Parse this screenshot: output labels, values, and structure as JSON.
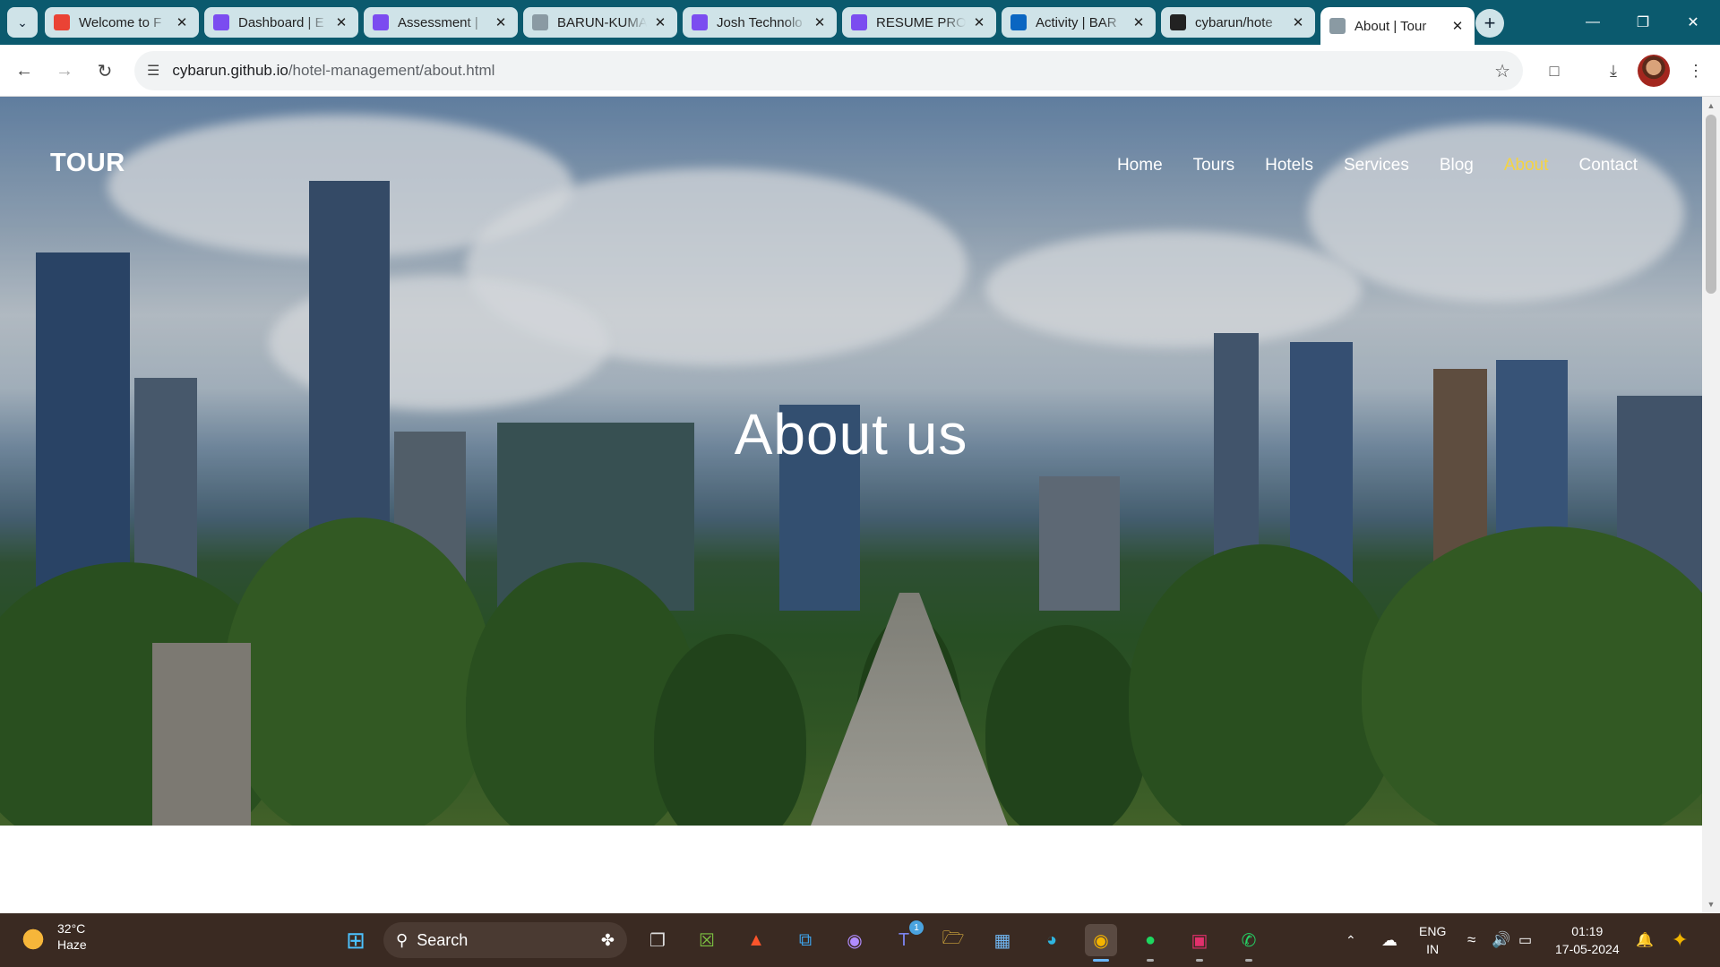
{
  "browser": {
    "tabs": [
      {
        "label": "Welcome to F",
        "favicon": "gmail-icon",
        "color": "#ea4335"
      },
      {
        "label": "Dashboard | E",
        "favicon": "unstop-icon",
        "color": "#7b4cf0"
      },
      {
        "label": "Assessment |",
        "favicon": "unstop-icon",
        "color": "#7b4cf0"
      },
      {
        "label": "BARUN-KUMAR",
        "favicon": "globe-icon",
        "color": "#8a9aa3"
      },
      {
        "label": "Josh Technolo",
        "favicon": "unstop-icon",
        "color": "#7b4cf0"
      },
      {
        "label": "RESUME PRO",
        "favicon": "unstop-icon",
        "color": "#7b4cf0"
      },
      {
        "label": "Activity | BAR",
        "favicon": "linkedin-icon",
        "color": "#0a66c2"
      },
      {
        "label": "cybarun/hote",
        "favicon": "github-icon",
        "color": "#222222"
      },
      {
        "label": "About | Tour",
        "favicon": "globe-icon",
        "color": "#8a9aa3",
        "active": true
      }
    ],
    "url_host": "cybarun.github.io",
    "url_path": "/hotel-management/about.html"
  },
  "site": {
    "brand": "TOUR",
    "nav": [
      "Home",
      "Tours",
      "Hotels",
      "Services",
      "Blog",
      "About",
      "Contact"
    ],
    "active_nav": "About",
    "hero_title": "About us",
    "active_color": "#f5d442"
  },
  "taskbar": {
    "temperature": "32°C",
    "weather": "Haze",
    "search_label": "Search",
    "lang_top": "ENG",
    "lang_bottom": "IN",
    "time": "01:19",
    "date": "17-05-2024",
    "teams_badge": "1",
    "apps": [
      "windows-start-icon",
      "task-view-icon",
      "xbox-icon",
      "brave-icon",
      "vscode-icon",
      "proton-icon",
      "teams-icon",
      "file-explorer-icon",
      "ms-store-icon",
      "edge-icon",
      "chrome-icon",
      "spotify-icon",
      "instagram-icon",
      "whatsapp-icon"
    ]
  }
}
